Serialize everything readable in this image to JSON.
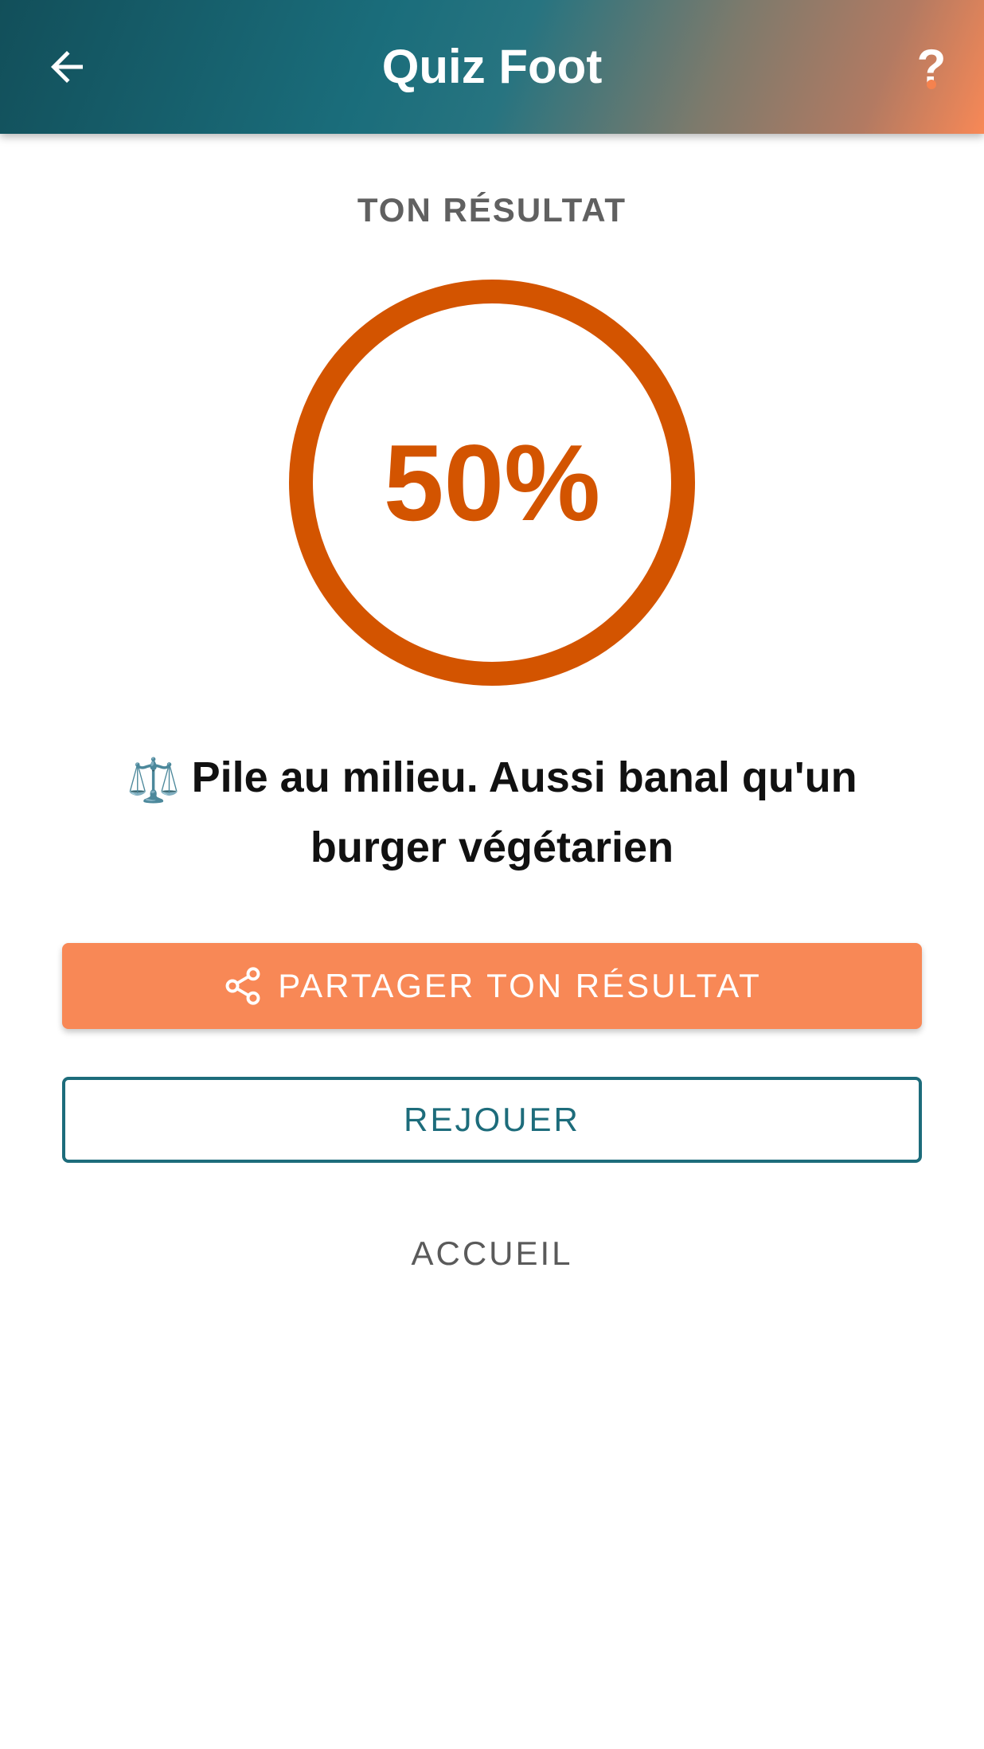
{
  "app_bar": {
    "title": "Quiz Foot",
    "back_icon": "arrow-left-icon",
    "help_label": "?",
    "help_icon": "question-mark-icon"
  },
  "result": {
    "label": "TON RÉSULTAT",
    "score_text": "50%",
    "score_fraction": 0.5,
    "ring_color": "#d35400",
    "verdict_emoji": "⚖️",
    "verdict_text": "Pile au milieu. Aussi banal qu'un burger végétarien"
  },
  "actions": {
    "share_label": "PARTAGER TON RÉSULTAT",
    "share_icon": "share-icon",
    "replay_label": "REJOUER",
    "home_label": "ACCUEIL"
  },
  "colors": {
    "accent": "#f88856",
    "primary": "#1d6c7b",
    "score": "#d35400"
  }
}
